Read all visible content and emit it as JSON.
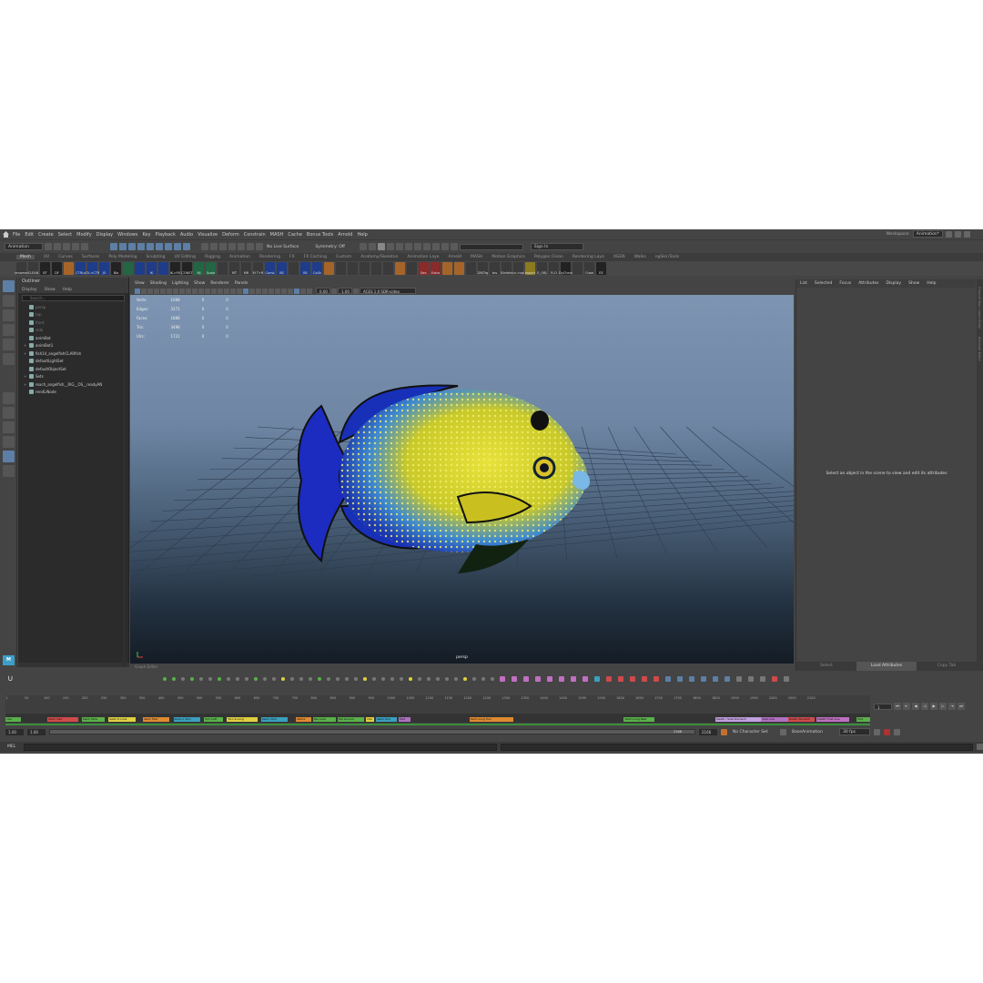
{
  "menubar": {
    "items": [
      "File",
      "Edit",
      "Create",
      "Select",
      "Modify",
      "Display",
      "Windows",
      "Key",
      "Playback",
      "Audio",
      "Visualize",
      "Deform",
      "Constrain",
      "MASH",
      "Cache",
      "Bonus Tools",
      "Arnold",
      "Help"
    ],
    "workspace_label": "Workspace:",
    "workspace_value": "Animation*"
  },
  "statusline": {
    "menuset": "Animation",
    "live_surface": "No Live Surface",
    "symmetry": "Symmetry: Off",
    "sign_in": "Sign In"
  },
  "shelf": {
    "tabs": [
      "Mesh",
      "UV",
      "Curves",
      "Surfaces",
      "Poly Modeling",
      "Sculpting",
      "UV Editing",
      "Rigging",
      "Animation",
      "Rendering",
      "FX",
      "FX Caching",
      "Custom",
      "Anatomy/Skeleton",
      "Animation Laye",
      "Arnold",
      "MASH",
      "Motion Graphics",
      "Polygon Clean",
      "Rendering Laye",
      "XGEN",
      "Walks",
      "ngSkinTools"
    ],
    "active_tab": "Mesh",
    "buttons": [
      {
        "label": "renamer",
        "color": "m"
      },
      {
        "label": "CLEAN",
        "color": "m"
      },
      {
        "label": "BT",
        "color": "k"
      },
      {
        "label": "DF",
        "color": "k"
      },
      {
        "label": "",
        "color": "o"
      },
      {
        "label": "CTRLs",
        "color": "n"
      },
      {
        "label": "CV->CTR",
        "color": "n"
      },
      {
        "label": "JO",
        "color": "n"
      },
      {
        "label": "Bla",
        "color": "k"
      },
      {
        "label": "",
        "color": "g"
      },
      {
        "label": "",
        "color": "n"
      },
      {
        "label": "IK",
        "color": "n"
      },
      {
        "label": "",
        "color": "n"
      },
      {
        "label": "IK->FK",
        "color": "k"
      },
      {
        "label": "CONST",
        "color": "k"
      },
      {
        "label": "MJ",
        "color": "g"
      },
      {
        "label": "Scale",
        "color": "g"
      },
      {
        "label": "",
        "color": "m"
      },
      {
        "label": "MT",
        "color": "m"
      },
      {
        "label": "MR",
        "color": "m"
      },
      {
        "label": "M T+R",
        "color": "m"
      },
      {
        "label": "Const",
        "color": "n"
      },
      {
        "label": "BS",
        "color": "n"
      },
      {
        "label": "",
        "color": "m"
      },
      {
        "label": "BS",
        "color": "n"
      },
      {
        "label": "CpSk",
        "color": "n"
      },
      {
        "label": "",
        "color": "o"
      },
      {
        "label": "",
        "color": "m"
      },
      {
        "label": "",
        "color": "m"
      },
      {
        "label": "",
        "color": "m"
      },
      {
        "label": "",
        "color": "m"
      },
      {
        "label": "",
        "color": "m"
      },
      {
        "label": "",
        "color": "o"
      },
      {
        "label": "",
        "color": "m"
      },
      {
        "label": "Bec",
        "color": "r"
      },
      {
        "label": "Extra",
        "color": "r"
      },
      {
        "label": "",
        "color": "o"
      },
      {
        "label": "",
        "color": "o"
      },
      {
        "label": "",
        "color": "m"
      },
      {
        "label": "DB/Trg",
        "color": "m"
      },
      {
        "label": "brs",
        "color": "m"
      },
      {
        "label": "Binlate",
        "color": "m"
      },
      {
        "label": "cv->spl",
        "color": "m"
      },
      {
        "label": "export",
        "color": "y"
      },
      {
        "label": "E_OBJ",
        "color": "m"
      },
      {
        "label": "R-O",
        "color": "m"
      },
      {
        "label": "DyChain",
        "color": "k"
      },
      {
        "label": "",
        "color": "m"
      },
      {
        "label": "Crow",
        "color": "m"
      },
      {
        "label": "EE",
        "color": "k"
      }
    ]
  },
  "outliner": {
    "title": "Outliner",
    "menu": [
      "Display",
      "Show",
      "Help"
    ],
    "search_placeholder": "Search...",
    "items": [
      {
        "label": "persp",
        "dim": true,
        "plus": ""
      },
      {
        "label": "top",
        "dim": true,
        "plus": ""
      },
      {
        "label": "front",
        "dim": true,
        "plus": ""
      },
      {
        "label": "side",
        "dim": true,
        "plus": ""
      },
      {
        "label": "animBot",
        "dim": false,
        "plus": ""
      },
      {
        "label": "animBot1",
        "dim": false,
        "plus": "+"
      },
      {
        "label": "fish14_angelfishCLARfish",
        "dim": false,
        "plus": "+"
      },
      {
        "label": "defaultLightSet",
        "dim": false,
        "plus": ""
      },
      {
        "label": "defaultObjectSet",
        "dim": false,
        "plus": ""
      },
      {
        "label": "Sets",
        "dim": false,
        "plus": "+"
      },
      {
        "label": "reach_angelfish__RIG__OS__readyAN",
        "dim": false,
        "plus": "+"
      },
      {
        "label": "rendLiNode",
        "dim": false,
        "plus": ""
      }
    ]
  },
  "viewport": {
    "menu": [
      "View",
      "Shading",
      "Lighting",
      "Show",
      "Renderer",
      "Panels"
    ],
    "exposure": "0.00",
    "gamma": "1.00",
    "colorspace": "ACES 1.0 SDR-video (sRGB)",
    "hud": [
      {
        "label": "Verts:",
        "a": "1098",
        "b": "0",
        "c": "0"
      },
      {
        "label": "Edges:",
        "a": "3171",
        "b": "0",
        "c": "0"
      },
      {
        "label": "Faces:",
        "a": "1888",
        "b": "0",
        "c": "0"
      },
      {
        "label": "Tris:",
        "a": "3498",
        "b": "0",
        "c": "0"
      },
      {
        "label": "UVs:",
        "a": "1721",
        "b": "0",
        "c": "0"
      }
    ],
    "camera": "persp",
    "footer": "Graph Editor"
  },
  "attribute_editor": {
    "menu": [
      "List",
      "Selected",
      "Focus",
      "Attributes",
      "Display",
      "Show",
      "Help"
    ],
    "message": "Select an object in the scene to view and edit its attributes",
    "tabs": [
      "Select",
      "Load Attributes",
      "Copy Tab"
    ],
    "active_tab": "Load Attributes"
  },
  "sidetabs": [
    "Channel Box / Layer Editor",
    "Attribute Editor"
  ],
  "timeslider": {
    "ticks": [
      "1",
      "50",
      "100",
      "150",
      "200",
      "250",
      "300",
      "350",
      "400",
      "450",
      "500",
      "550",
      "600",
      "650",
      "700",
      "750",
      "800",
      "850",
      "900",
      "950",
      "1000",
      "1050",
      "1100",
      "1150",
      "1200",
      "1250",
      "1300",
      "1350",
      "1400",
      "1450",
      "1500",
      "1550",
      "1600",
      "1650",
      "1700",
      "1750",
      "1800",
      "1850",
      "1900",
      "1950",
      "2000",
      "2050",
      "2100"
    ],
    "current_frame": "1",
    "clips": [
      {
        "label": "Idle",
        "start": 1,
        "end": 40,
        "color": "#5ab04a"
      },
      {
        "label": "Swim Fwd",
        "start": 110,
        "end": 190,
        "color": "#d04a4a"
      },
      {
        "label": "Swim Slow",
        "start": 200,
        "end": 260,
        "color": "#5ab04a"
      },
      {
        "label": "Swim R Look",
        "start": 270,
        "end": 340,
        "color": "#e0d040"
      },
      {
        "label": "Swim Fast",
        "start": 360,
        "end": 430,
        "color": "#e08a30"
      },
      {
        "label": "Swim L Turn",
        "start": 440,
        "end": 510,
        "color": "#3aa0c0"
      },
      {
        "label": "Turn Left",
        "start": 520,
        "end": 570,
        "color": "#5ab04a"
      },
      {
        "label": "Turn R Long",
        "start": 580,
        "end": 660,
        "color": "#e0d040"
      },
      {
        "label": "Swim Chill",
        "start": 670,
        "end": 740,
        "color": "#3aa0c0"
      },
      {
        "label": "Attack",
        "start": 760,
        "end": 800,
        "color": "#e08a30"
      },
      {
        "label": "Idle Look",
        "start": 805,
        "end": 865,
        "color": "#5ab04a"
      },
      {
        "label": "Eat Ground",
        "start": 870,
        "end": 940,
        "color": "#5ab04a"
      },
      {
        "label": "Idle",
        "start": 945,
        "end": 965,
        "color": "#e0d040"
      },
      {
        "label": "Swim Turn",
        "start": 970,
        "end": 1025,
        "color": "#3aa0c0"
      },
      {
        "label": "Fast",
        "start": 1030,
        "end": 1060,
        "color": "#b070c0"
      },
      {
        "label": "Swim Long Turn",
        "start": 1215,
        "end": 1330,
        "color": "#e08a30"
      },
      {
        "label": "Swim Long Rest",
        "start": 1620,
        "end": 1700,
        "color": "#5ab04a"
      },
      {
        "label": "Death / Side Stomach",
        "start": 1860,
        "end": 1980,
        "color": "#c0a0e0"
      },
      {
        "label": "Side Live",
        "start": 1980,
        "end": 2050,
        "color": "#b070c0"
      },
      {
        "label": "Death Stomach",
        "start": 2050,
        "end": 2120,
        "color": "#d04a4a"
      },
      {
        "label": "Death Float Live",
        "start": 2125,
        "end": 2210,
        "color": "#c070c0"
      },
      {
        "label": "End",
        "start": 2230,
        "end": 2265,
        "color": "#5ab04a"
      }
    ],
    "range_max": 2265
  },
  "rangebar": {
    "start": "1.00",
    "inner_start": "1.00",
    "inner_end": "2166",
    "end": "2166",
    "character_set": "No Character Set",
    "anim_layer": "BaseAnimation",
    "fps": "30 fps"
  },
  "melbar": {
    "label": "MEL"
  },
  "colors": {
    "accent": "#5d7fa6",
    "maya_logo": "#3c9ec9"
  }
}
